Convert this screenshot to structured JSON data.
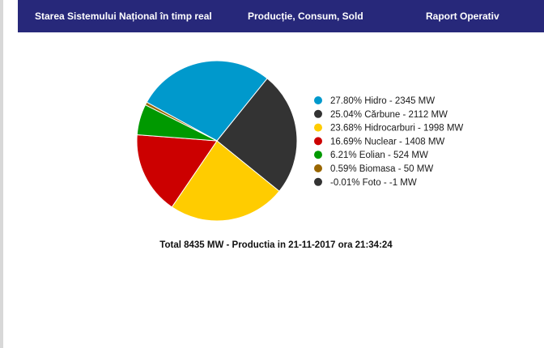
{
  "nav": {
    "items": [
      {
        "label": "Starea Sistemului Național în timp real"
      },
      {
        "label": "Producție, Consum, Sold"
      },
      {
        "label": "Raport Operativ"
      }
    ],
    "background": "#27287a"
  },
  "chart_data": {
    "type": "pie",
    "title": "",
    "slices": [
      {
        "label": "27.80% Hidro - 2345 MW",
        "value": 2345,
        "percent": 27.8,
        "color": "#0099cc"
      },
      {
        "label": "25.04% Cărbune - 2112 MW",
        "value": 2112,
        "percent": 25.04,
        "color": "#333333"
      },
      {
        "label": "23.68% Hidrocarburi - 1998 MW",
        "value": 1998,
        "percent": 23.68,
        "color": "#ffcc00"
      },
      {
        "label": "16.69% Nuclear - 1408 MW",
        "value": 1408,
        "percent": 16.69,
        "color": "#cc0000"
      },
      {
        "label": "6.21% Eolian - 524 MW",
        "value": 524,
        "percent": 6.21,
        "color": "#009900"
      },
      {
        "label": "0.59% Biomasa - 50 MW",
        "value": 50,
        "percent": 0.59,
        "color": "#996600"
      },
      {
        "label": "-0.01% Foto - -1 MW",
        "value": -1,
        "percent": -0.01,
        "color": "#333333"
      }
    ],
    "legend_position": "right"
  },
  "total_text": "Total 8435 MW - Productia in 21-11-2017 ora 21:34:24"
}
